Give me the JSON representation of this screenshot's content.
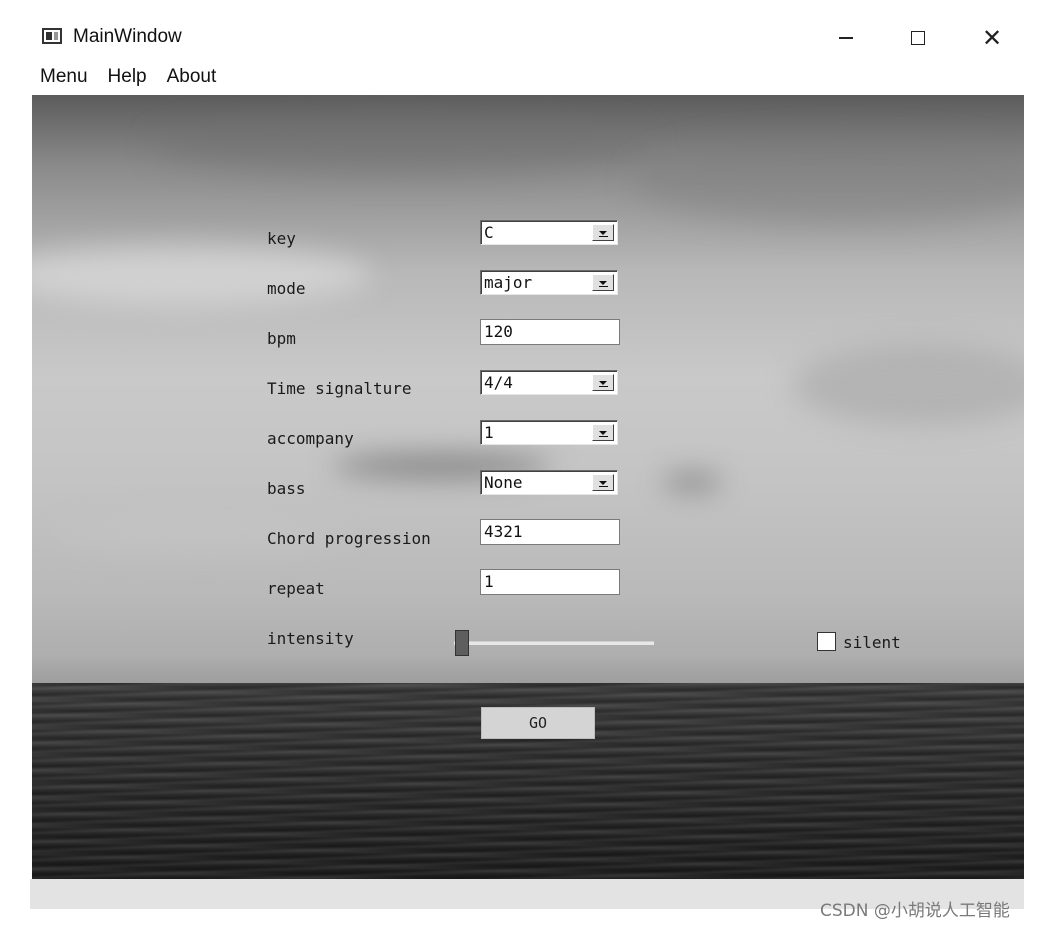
{
  "window": {
    "title": "MainWindow",
    "icon": "app-window-icon",
    "controls": {
      "minimize": "minimize-icon",
      "maximize": "maximize-icon",
      "close": "close-icon"
    }
  },
  "menubar": {
    "items": [
      {
        "label": "Menu"
      },
      {
        "label": "Help"
      },
      {
        "label": "About"
      }
    ]
  },
  "form": {
    "key": {
      "label": "key",
      "value": "C"
    },
    "mode": {
      "label": "mode",
      "value": "major"
    },
    "bpm": {
      "label": "bpm",
      "value": "120"
    },
    "time_signature": {
      "label": "Time signalture",
      "value": "4/4"
    },
    "accompany": {
      "label": "accompany",
      "value": "1"
    },
    "bass": {
      "label": "bass",
      "value": "None"
    },
    "chord_progression": {
      "label": "Chord progression",
      "value": "4321"
    },
    "repeat": {
      "label": "repeat",
      "value": "1"
    },
    "intensity": {
      "label": "intensity",
      "slider_level": 0.0
    },
    "silent": {
      "label": "silent",
      "checked": false
    }
  },
  "go_button": {
    "label": "GO"
  },
  "watermark": "CSDN @小胡说人工智能"
}
